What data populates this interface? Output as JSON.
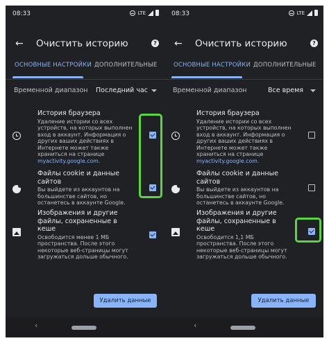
{
  "screens": [
    {
      "status": {
        "time": "08:33",
        "network": "LTE"
      },
      "title": "Очистить историю",
      "tabs": [
        "ОСНОВНЫЕ НАСТРОЙКИ",
        "ДОПОЛНИТЕЛЬНЫЕ"
      ],
      "time_range": {
        "label": "Временной диапазон",
        "value": "Последний час"
      },
      "items": [
        {
          "title": "История браузера",
          "desc": "Удаление истории со всех устройств, на которых выполнен вход в аккаунт. Информация о других ваших действиях в Интернете может также храниться на странице",
          "link": "myactivity.google.com.",
          "checked": true
        },
        {
          "title": "Файлы cookie и данные сайтов",
          "desc": "Вы выйдете из аккаунтов на большинстве сайтов, но останетесь в аккаунте Google.",
          "checked": true
        },
        {
          "title": "Изображения и другие файлы, сохраненные в кеше",
          "desc": "Освободится менее 1 МБ пространства. После этого некоторые веб-страницы могут загружаться дольше обычного.",
          "checked": true
        }
      ],
      "button": "Удалить данные"
    },
    {
      "status": {
        "time": "08:33",
        "network": "LTE"
      },
      "title": "Очистить историю",
      "tabs": [
        "ОСНОВНЫЕ НАСТРОЙКИ",
        "ДОПОЛНИТЕЛЬНЫЕ"
      ],
      "time_range": {
        "label": "Временной диапазон",
        "value": "Все время"
      },
      "items": [
        {
          "title": "История браузера",
          "desc": "Удаление истории со всех устройств, на которых выполнен вход в аккаунт. Информация о других ваших действиях в Интернете может также храниться на странице",
          "link": "myactivity.google.com.",
          "checked": false
        },
        {
          "title": "Файлы cookie и данные сайтов",
          "desc": "Вы выйдете из аккаунтов на большинстве сайтов, но останетесь в аккаунте Google.",
          "checked": false
        },
        {
          "title": "Изображения и другие файлы, сохраненные в кеше",
          "desc": "Освободится 1,1 МБ пространства. После этого некоторые веб-страницы могут загружаться дольше обычного.",
          "checked": true
        }
      ],
      "button": "Удалить данные"
    }
  ],
  "icons": {
    "back": "arrow-left-icon",
    "help": "help-icon",
    "items": [
      "clock-icon",
      "cookie-icon",
      "image-icon"
    ],
    "nav_back": "nav-back-icon"
  },
  "colors": {
    "background": "#202124",
    "accent": "#8ab4f8",
    "highlight": "#5bd641",
    "text": "#e8eaed",
    "secondary_text": "#bdc1c6"
  }
}
